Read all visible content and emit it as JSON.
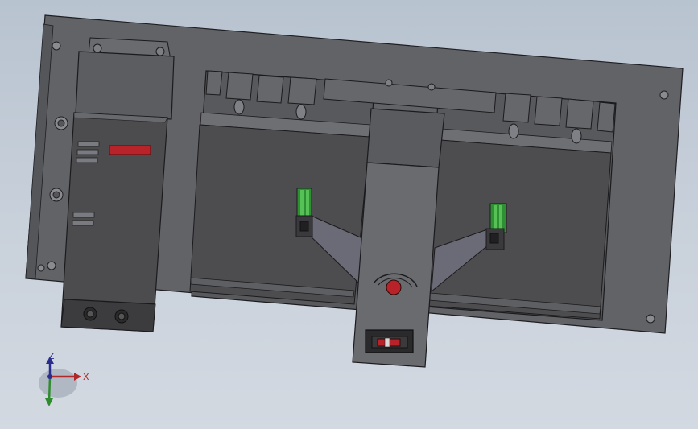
{
  "viewport": {
    "background_top": "#b8c3d0",
    "background_bottom": "#d3d9e1"
  },
  "model": {
    "panel_color": "#5f6064",
    "dark_face_color": "#4b4b4b",
    "indicator_red": "#c1272d",
    "lever_green": "#3da33d",
    "components": [
      {
        "name": "mounting-plate"
      },
      {
        "name": "controller-module"
      },
      {
        "name": "breaker-left"
      },
      {
        "name": "breaker-right"
      },
      {
        "name": "operating-handle"
      },
      {
        "name": "interlock-links"
      }
    ]
  },
  "triad": {
    "x_label": "X",
    "z_label": "Z",
    "x_color": "#b0282a",
    "y_color": "#2e8b2e",
    "z_color": "#2a2d8f"
  }
}
